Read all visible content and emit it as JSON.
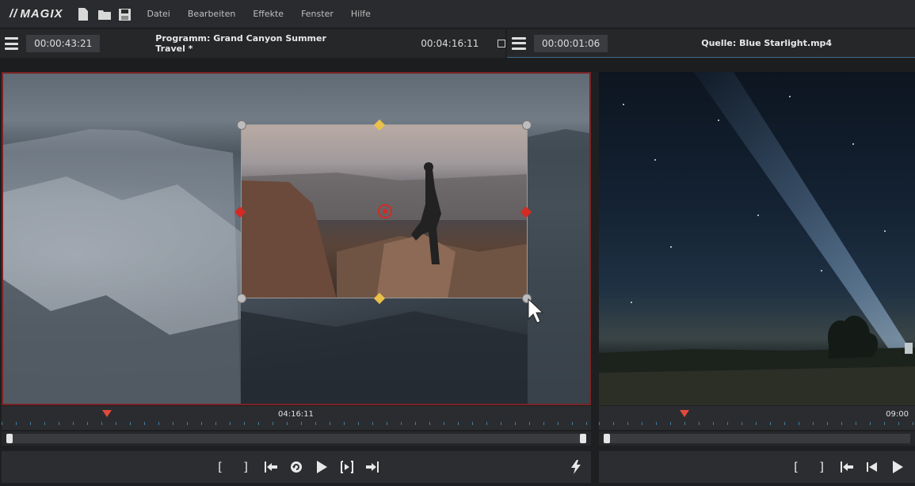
{
  "app": {
    "logo": "MAGIX",
    "logo_prefix": "//"
  },
  "menu": {
    "items": [
      "Datei",
      "Bearbeiten",
      "Effekte",
      "Fenster",
      "Hilfe"
    ]
  },
  "program": {
    "position_tc": "00:00:43:21",
    "title": "Programm: Grand Canyon Summer Travel *",
    "duration_tc": "00:04:16:11",
    "ruler_time": "04:16:11"
  },
  "source": {
    "position_tc": "00:00:01:06",
    "title": "Quelle: Blue Starlight.mp4",
    "ruler_time": "09:00"
  },
  "transport_left": {
    "mark_in": "[",
    "mark_out": "]"
  },
  "transport_right": {
    "mark_in": "[",
    "mark_out": "]"
  },
  "colors": {
    "accent_red": "#e34a3c",
    "handle_yellow": "#e9c14a",
    "border_blue": "#3b6e88"
  },
  "icons": [
    "new-file-icon",
    "open-folder-icon",
    "save-icon",
    "menu-icon",
    "playhead-icon",
    "play-icon",
    "loop-icon",
    "flash-icon"
  ]
}
